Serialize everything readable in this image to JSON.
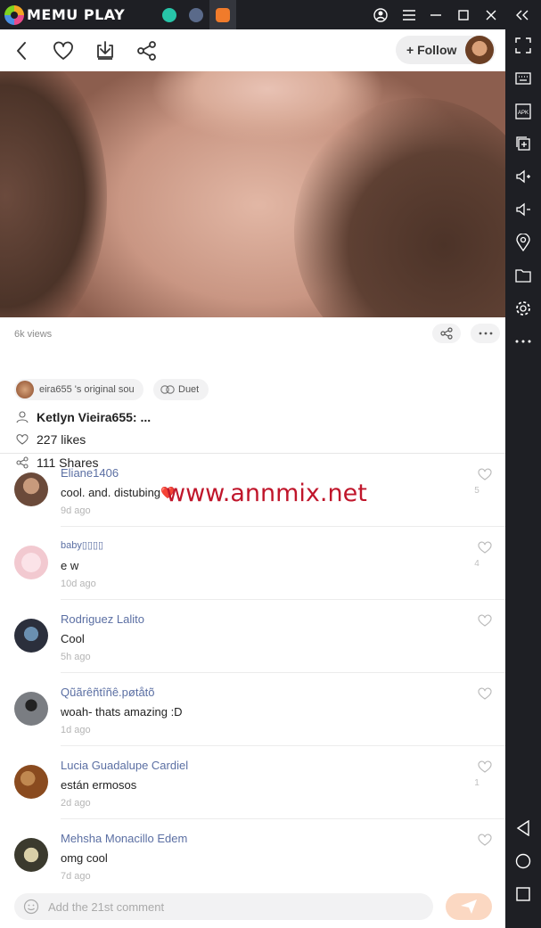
{
  "window": {
    "brand": "MEMU PLAY",
    "tabs": [
      {
        "name": "app-tab-1",
        "color": "#27c4a8"
      },
      {
        "name": "telegram-tab",
        "color": "#5a6a8a"
      },
      {
        "name": "snack-video-tab",
        "color": "#f07b2b"
      }
    ]
  },
  "topbar": {
    "follow_label": "+ Follow"
  },
  "meta": {
    "views": "6k views",
    "sound": "eira655 's original sou",
    "duet": "Duet",
    "author": "Ketlyn Vieira655: ...",
    "likes": "227 likes",
    "shares": "111 Shares"
  },
  "watermark": "www.annmix.net",
  "comments": [
    {
      "user": "Eliane1406",
      "text": "cool.  and.  distubing❤️",
      "time": "9d ago",
      "likes": "5",
      "avatar": "#6b4a3a"
    },
    {
      "user": "baby▯▯▯▯",
      "text": "e w",
      "time": "10d ago",
      "likes": "4",
      "avatar": "#f2c9d0"
    },
    {
      "user": "Rodriguez Lalito",
      "text": "Cool",
      "time": "5h ago",
      "likes": "",
      "avatar": "#2b2f3c"
    },
    {
      "user": "Qũãrêñtîñê.pøtåtõ",
      "text": "woah- thats amazing :D",
      "time": "1d ago",
      "likes": "",
      "avatar": "#4a4d52"
    },
    {
      "user": "Lucia Guadalupe Cardiel",
      "text": "están ermosos",
      "time": "2d ago",
      "likes": "1",
      "avatar": "#8a4b1f"
    },
    {
      "user": "Mehsha Monacillo Edem",
      "text": "omg cool",
      "time": "7d ago",
      "likes": "",
      "avatar": "#3b3a2e"
    }
  ],
  "bottom": {
    "placeholder": "Add the 21st comment"
  },
  "colors": {
    "accent": "#fbd8c2",
    "username": "#5b6fa3",
    "watermark": "#c0162b"
  }
}
